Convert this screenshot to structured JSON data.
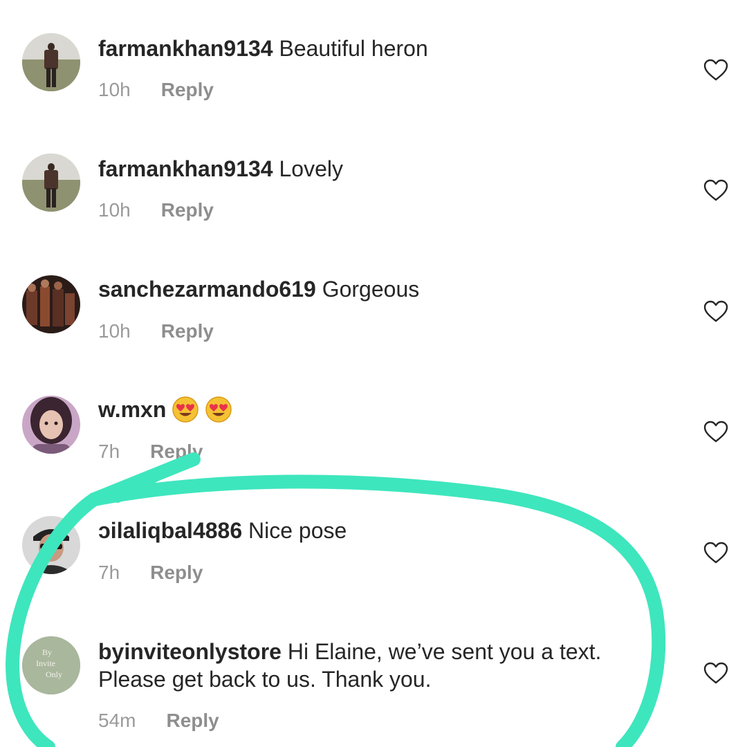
{
  "comments": [
    {
      "username": "farmankhan9134",
      "text": "Beautiful heron",
      "time": "10h",
      "reply": "Reply",
      "avatar": "man-standing-field-avatar",
      "like_icon": "heart-outline-icon"
    },
    {
      "username": "farmankhan9134",
      "text": "Lovely",
      "time": "10h",
      "reply": "Reply",
      "avatar": "man-standing-field-avatar",
      "like_icon": "heart-outline-icon"
    },
    {
      "username": "sanchezarmando619",
      "text": "Gorgeous",
      "time": "10h",
      "reply": "Reply",
      "avatar": "group-photo-avatar",
      "like_icon": "heart-outline-icon"
    },
    {
      "username": "w.mxn",
      "text": "",
      "emojis": [
        "heart-eyes-emoji",
        "heart-eyes-emoji"
      ],
      "time": "7h",
      "reply": "Reply",
      "avatar": "woman-selfie-avatar",
      "like_icon": "heart-outline-icon"
    },
    {
      "username": "ɔilaliqbal4886",
      "text": "Nice pose",
      "time": "7h",
      "reply": "Reply",
      "avatar": "man-cap-sunglasses-avatar",
      "like_icon": "heart-outline-icon"
    },
    {
      "username": "byinviteonlystore",
      "text": "Hi Elaine, we’ve sent you a text.",
      "text_line2": "Please get back to us. Thank you.",
      "time": "54m",
      "reply": "Reply",
      "avatar": "by-invite-only-logo-avatar",
      "avatar_logo_lines": [
        "By",
        "Invite",
        "Only"
      ],
      "like_icon": "heart-outline-icon"
    }
  ],
  "colors": {
    "text": "#262626",
    "meta": "#9a9a9a",
    "highlight_marker": "#3ee6bd",
    "logo_avatar_bg": "#a9b79d"
  },
  "annotation": "hand-drawn-teal-highlight-circle"
}
